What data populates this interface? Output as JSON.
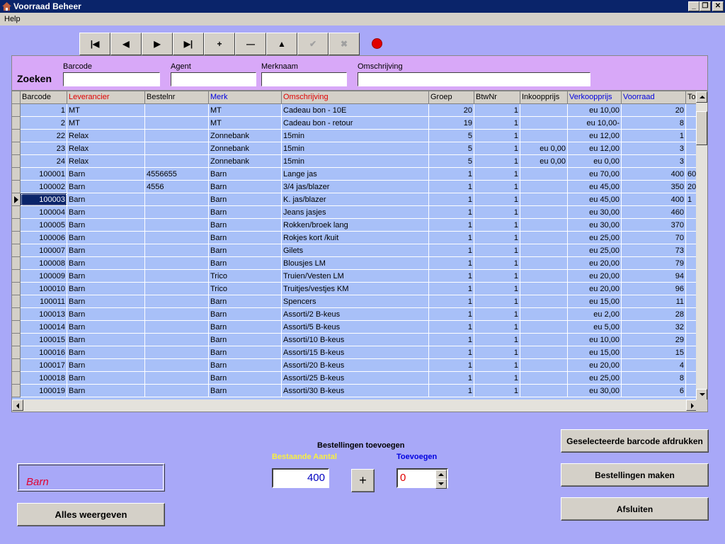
{
  "window": {
    "title": "Voorraad Beheer"
  },
  "menu": {
    "help": "Help"
  },
  "colors": {
    "accent": "#0a246a",
    "panel": "#d8a8f8",
    "background": "#a8a8f8",
    "red_indicator": "#e00000"
  },
  "nav_buttons": [
    {
      "name": "first-record-button",
      "glyph": "|◀",
      "enabled": true
    },
    {
      "name": "prior-record-button",
      "glyph": "◀",
      "enabled": true
    },
    {
      "name": "next-record-button",
      "glyph": "▶",
      "enabled": true
    },
    {
      "name": "last-record-button",
      "glyph": "▶|",
      "enabled": true
    },
    {
      "name": "insert-record-button",
      "glyph": "+",
      "enabled": true
    },
    {
      "name": "delete-record-button",
      "glyph": "—",
      "enabled": true
    },
    {
      "name": "edit-record-button",
      "glyph": "▲",
      "enabled": true
    },
    {
      "name": "post-record-button",
      "glyph": "✔",
      "enabled": false
    },
    {
      "name": "cancel-record-button",
      "glyph": "✖",
      "enabled": false
    }
  ],
  "search": {
    "title": "Zoeken",
    "fields": [
      {
        "label": "Barcode",
        "value": ""
      },
      {
        "label": "Agent",
        "value": ""
      },
      {
        "label": "Merknaam",
        "value": ""
      },
      {
        "label": "Omschrijving",
        "value": ""
      }
    ]
  },
  "table": {
    "columns": [
      {
        "label": "Barcode",
        "color": "#000000"
      },
      {
        "label": "Leverancier",
        "color": "#e00000"
      },
      {
        "label": "Bestelnr",
        "color": "#000000"
      },
      {
        "label": "Merk",
        "color": "#0000e0"
      },
      {
        "label": "Omschrijving",
        "color": "#e00000"
      },
      {
        "label": "Groep",
        "color": "#000000"
      },
      {
        "label": "BtwNr",
        "color": "#000000"
      },
      {
        "label": "Inkoopprijs",
        "color": "#000000"
      },
      {
        "label": "Verkoopprijs",
        "color": "#0000e0"
      },
      {
        "label": "Voorraad",
        "color": "#0000e0"
      },
      {
        "label": "To",
        "color": "#000000"
      }
    ],
    "selected_row": 7,
    "rows": [
      [
        "1",
        "MT",
        "",
        "MT",
        "Cadeau bon - 10E",
        "20",
        "1",
        "",
        "eu 10,00",
        "20",
        ""
      ],
      [
        "2",
        "MT",
        "",
        "MT",
        "Cadeau bon - retour",
        "19",
        "1",
        "",
        "eu 10,00-",
        "8",
        ""
      ],
      [
        "22",
        "Relax",
        "",
        "Zonnebank",
        "15min",
        "5",
        "1",
        "",
        "eu 12,00",
        "1",
        ""
      ],
      [
        "23",
        "Relax",
        "",
        "Zonnebank",
        "15min",
        "5",
        "1",
        "eu 0,00",
        "eu 12,00",
        "3",
        ""
      ],
      [
        "24",
        "Relax",
        "",
        "Zonnebank",
        "15min",
        "5",
        "1",
        "eu 0,00",
        "eu 0,00",
        "3",
        ""
      ],
      [
        "100001",
        "Barn",
        "4556655",
        "Barn",
        "Lange jas",
        "1",
        "1",
        "",
        "eu 70,00",
        "400",
        "60"
      ],
      [
        "100002",
        "Barn",
        "4556",
        "Barn",
        "3/4 jas/blazer",
        "1",
        "1",
        "",
        "eu 45,00",
        "350",
        "20"
      ],
      [
        "100003",
        "Barn",
        "",
        "Barn",
        "K. jas/blazer",
        "1",
        "1",
        "",
        "eu 45,00",
        "400",
        "1"
      ],
      [
        "100004",
        "Barn",
        "",
        "Barn",
        "Jeans jasjes",
        "1",
        "1",
        "",
        "eu 30,00",
        "460",
        ""
      ],
      [
        "100005",
        "Barn",
        "",
        "Barn",
        "Rokken/broek lang",
        "1",
        "1",
        "",
        "eu 30,00",
        "370",
        ""
      ],
      [
        "100006",
        "Barn",
        "",
        "Barn",
        "Rokjes kort /kuit",
        "1",
        "1",
        "",
        "eu 25,00",
        "70",
        ""
      ],
      [
        "100007",
        "Barn",
        "",
        "Barn",
        "Gilets",
        "1",
        "1",
        "",
        "eu 25,00",
        "73",
        ""
      ],
      [
        "100008",
        "Barn",
        "",
        "Barn",
        "Blousjes LM",
        "1",
        "1",
        "",
        "eu 20,00",
        "79",
        ""
      ],
      [
        "100009",
        "Barn",
        "",
        "Trico",
        "Truien/Vesten LM",
        "1",
        "1",
        "",
        "eu 20,00",
        "94",
        ""
      ],
      [
        "100010",
        "Barn",
        "",
        "Trico",
        "Truitjes/vestjes KM",
        "1",
        "1",
        "",
        "eu 20,00",
        "96",
        ""
      ],
      [
        "100011",
        "Barn",
        "",
        "Barn",
        "Spencers",
        "1",
        "1",
        "",
        "eu 15,00",
        "11",
        ""
      ],
      [
        "100013",
        "Barn",
        "",
        "Barn",
        "Assorti/2 B-keus",
        "1",
        "1",
        "",
        "eu 2,00",
        "28",
        ""
      ],
      [
        "100014",
        "Barn",
        "",
        "Barn",
        "Assorti/5 B-keus",
        "1",
        "1",
        "",
        "eu 5,00",
        "32",
        ""
      ],
      [
        "100015",
        "Barn",
        "",
        "Barn",
        "Assorti/10 B-keus",
        "1",
        "1",
        "",
        "eu 10,00",
        "29",
        ""
      ],
      [
        "100016",
        "Barn",
        "",
        "Barn",
        "Assorti/15 B-keus",
        "1",
        "1",
        "",
        "eu 15,00",
        "15",
        ""
      ],
      [
        "100017",
        "Barn",
        "",
        "Barn",
        "Assorti/20 B-keus",
        "1",
        "1",
        "",
        "eu 20,00",
        "4",
        ""
      ],
      [
        "100018",
        "Barn",
        "",
        "Barn",
        "Assorti/25 B-keus",
        "1",
        "1",
        "",
        "eu 25,00",
        "8",
        ""
      ],
      [
        "100019",
        "Barn",
        "",
        "Barn",
        "Assorti/30 B-keus",
        "1",
        "1",
        "",
        "eu 30,00",
        "6",
        ""
      ]
    ]
  },
  "filter": {
    "value": "Barn"
  },
  "orders": {
    "title": "Bestellingen toevoegen",
    "existing_label": "Bestaande Aantal",
    "existing_value": "400",
    "add_label": "Toevoegen",
    "add_value": "0",
    "plus_label": "+"
  },
  "buttons": {
    "show_all": "Alles weergeven",
    "print_barcode": "Geselecteerde barcode afdrukken",
    "make_orders": "Bestellingen maken",
    "close": "Afsluiten"
  }
}
